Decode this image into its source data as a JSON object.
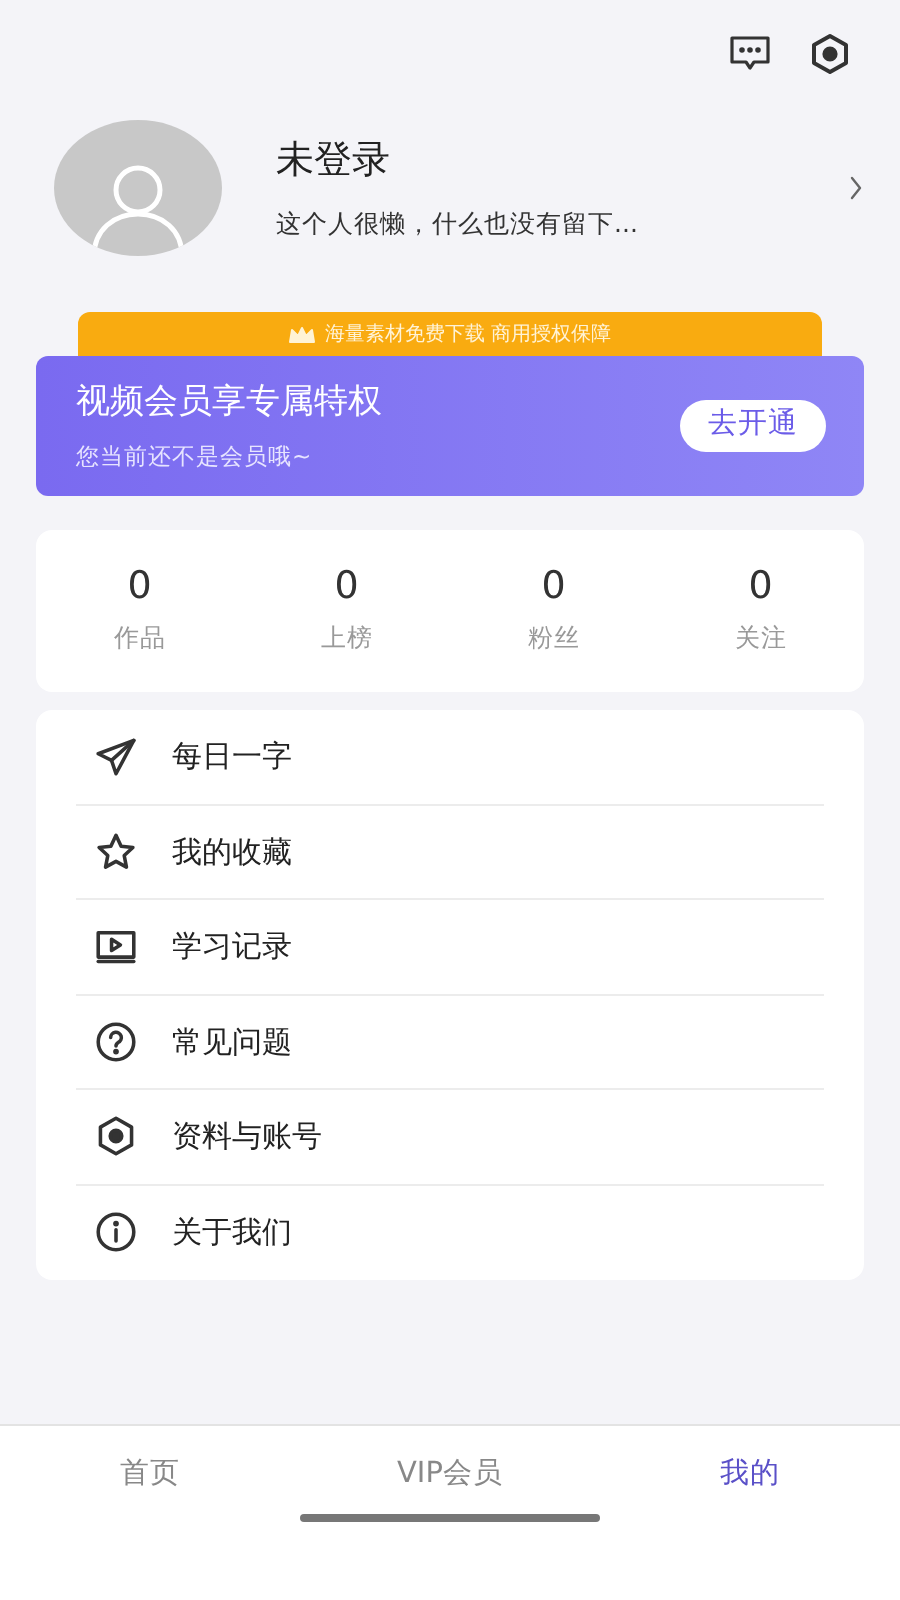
{
  "profile": {
    "name": "未登录",
    "bio": "这个人很懒，什么也没有留下..."
  },
  "vip": {
    "strip": "海量素材免费下载 商用授权保障",
    "title": "视频会员享专属特权",
    "subtitle": "您当前还不是会员哦~",
    "button": "去开通"
  },
  "stats": [
    {
      "value": "0",
      "label": "作品"
    },
    {
      "value": "0",
      "label": "上榜"
    },
    {
      "value": "0",
      "label": "粉丝"
    },
    {
      "value": "0",
      "label": "关注"
    }
  ],
  "menu": [
    {
      "kind": "send",
      "label": "每日一字"
    },
    {
      "kind": "star",
      "label": "我的收藏"
    },
    {
      "kind": "video",
      "label": "学习记录"
    },
    {
      "kind": "question",
      "label": "常见问题"
    },
    {
      "kind": "hexagon",
      "label": "资料与账号"
    },
    {
      "kind": "info",
      "label": "关于我们"
    }
  ],
  "tabs": [
    {
      "label": "首页",
      "selected": false
    },
    {
      "label": "VIP会员",
      "selected": false
    },
    {
      "label": "我的",
      "selected": true
    }
  ]
}
